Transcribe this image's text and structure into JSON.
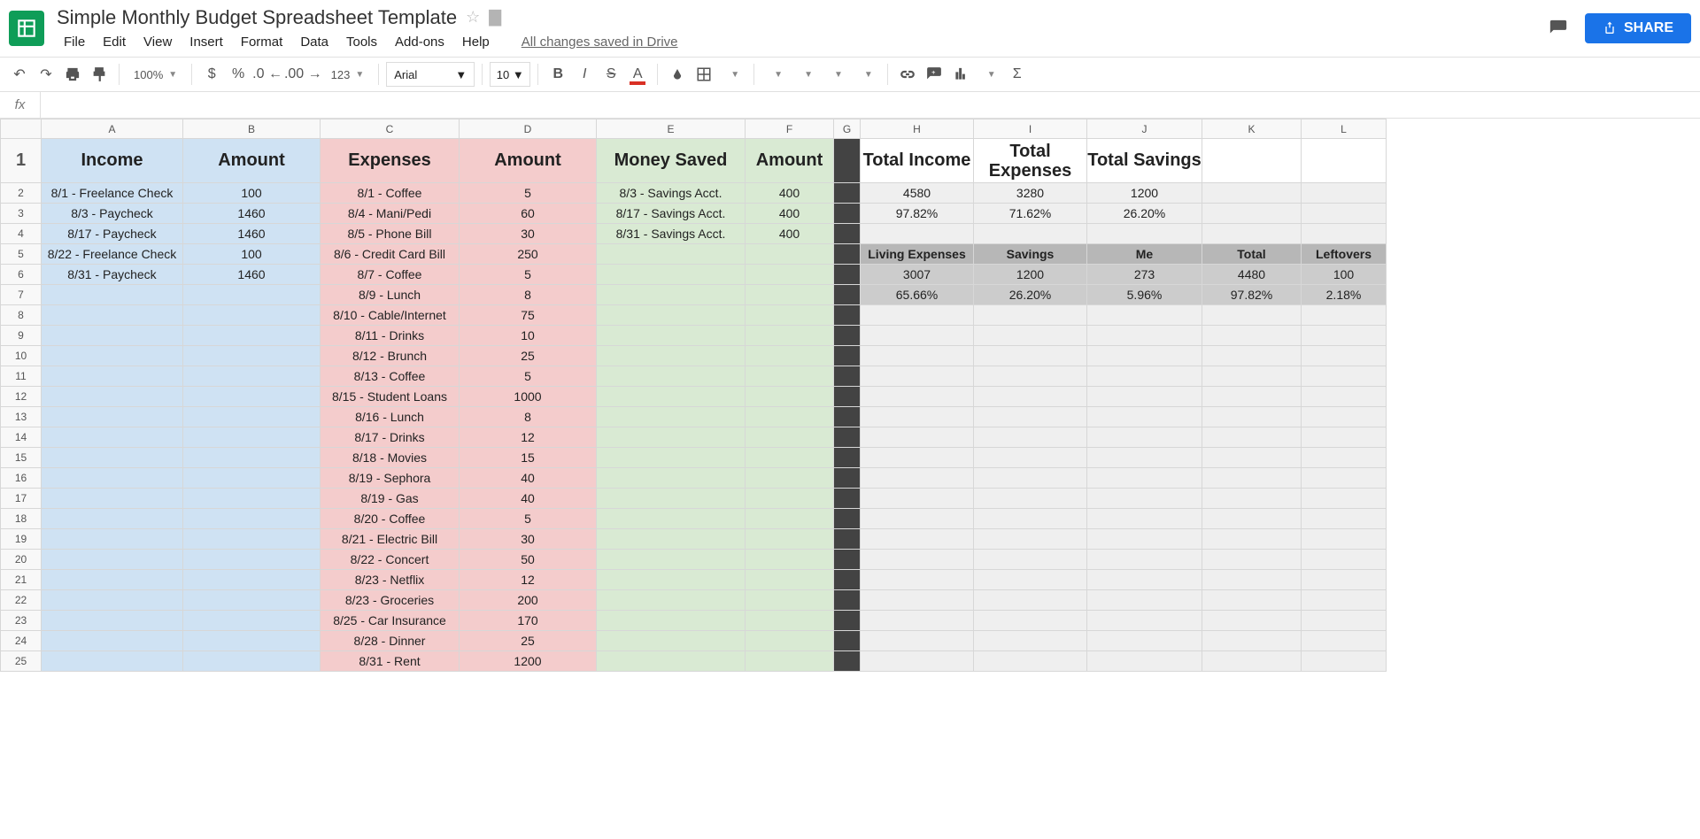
{
  "doc_title": "Simple Monthly Budget Spreadsheet Template",
  "saved_msg": "All changes saved in Drive",
  "share_label": "SHARE",
  "menu": [
    "File",
    "Edit",
    "View",
    "Insert",
    "Format",
    "Data",
    "Tools",
    "Add-ons",
    "Help"
  ],
  "toolbar": {
    "zoom": "100%",
    "num_fmt": "123",
    "font": "Arial",
    "font_size": "10"
  },
  "columns": [
    "A",
    "B",
    "C",
    "D",
    "E",
    "F",
    "G",
    "H",
    "I",
    "J",
    "K",
    "L"
  ],
  "headers_row1": {
    "A": "Income",
    "B": "Amount",
    "C": "Expenses",
    "D": "Amount",
    "E": "Money Saved",
    "F": "Amount",
    "G": "",
    "H": "Total Income",
    "I": "Total Expenses",
    "J": "Total Savings",
    "K": "",
    "L": ""
  },
  "income": [
    {
      "a": "8/1 - Freelance Check",
      "b": "100"
    },
    {
      "a": "8/3 - Paycheck",
      "b": "1460"
    },
    {
      "a": "8/17 - Paycheck",
      "b": "1460"
    },
    {
      "a": "8/22 - Freelance Check",
      "b": "100"
    },
    {
      "a": "8/31 - Paycheck",
      "b": "1460"
    }
  ],
  "expenses": [
    {
      "c": "8/1 - Coffee",
      "d": "5"
    },
    {
      "c": "8/4 - Mani/Pedi",
      "d": "60"
    },
    {
      "c": "8/5 - Phone Bill",
      "d": "30"
    },
    {
      "c": "8/6 - Credit Card Bill",
      "d": "250"
    },
    {
      "c": "8/7 - Coffee",
      "d": "5"
    },
    {
      "c": "8/9 - Lunch",
      "d": "8"
    },
    {
      "c": "8/10 - Cable/Internet",
      "d": "75"
    },
    {
      "c": "8/11 - Drinks",
      "d": "10"
    },
    {
      "c": "8/12 - Brunch",
      "d": "25"
    },
    {
      "c": "8/13 - Coffee",
      "d": "5"
    },
    {
      "c": "8/15 - Student Loans",
      "d": "1000"
    },
    {
      "c": "8/16 - Lunch",
      "d": "8"
    },
    {
      "c": "8/17 - Drinks",
      "d": "12"
    },
    {
      "c": "8/18 - Movies",
      "d": "15"
    },
    {
      "c": "8/19 - Sephora",
      "d": "40"
    },
    {
      "c": "8/19 - Gas",
      "d": "40"
    },
    {
      "c": "8/20 - Coffee",
      "d": "5"
    },
    {
      "c": "8/21 - Electric Bill",
      "d": "30"
    },
    {
      "c": "8/22 - Concert",
      "d": "50"
    },
    {
      "c": "8/23 - Netflix",
      "d": "12"
    },
    {
      "c": "8/23 - Groceries",
      "d": "200"
    },
    {
      "c": "8/25 - Car Insurance",
      "d": "170"
    },
    {
      "c": "8/28 - Dinner",
      "d": "25"
    },
    {
      "c": "8/31 - Rent",
      "d": "1200"
    }
  ],
  "saved": [
    {
      "e": "8/3 - Savings Acct.",
      "f": "400"
    },
    {
      "e": "8/17 - Savings Acct.",
      "f": "400"
    },
    {
      "e": "8/31 - Savings Acct.",
      "f": "400"
    }
  ],
  "totals1": {
    "H": "4580",
    "I": "3280",
    "J": "1200"
  },
  "totals2": {
    "H": "97.82%",
    "I": "71.62%",
    "J": "26.20%"
  },
  "summary_head": {
    "H": "Living Expenses",
    "I": "Savings",
    "J": "Me",
    "K": "Total",
    "L": "Leftovers"
  },
  "summary_vals": {
    "H": "3007",
    "I": "1200",
    "J": "273",
    "K": "4480",
    "L": "100"
  },
  "summary_pct": {
    "H": "65.66%",
    "I": "26.20%",
    "J": "5.96%",
    "K": "97.82%",
    "L": "2.18%"
  }
}
